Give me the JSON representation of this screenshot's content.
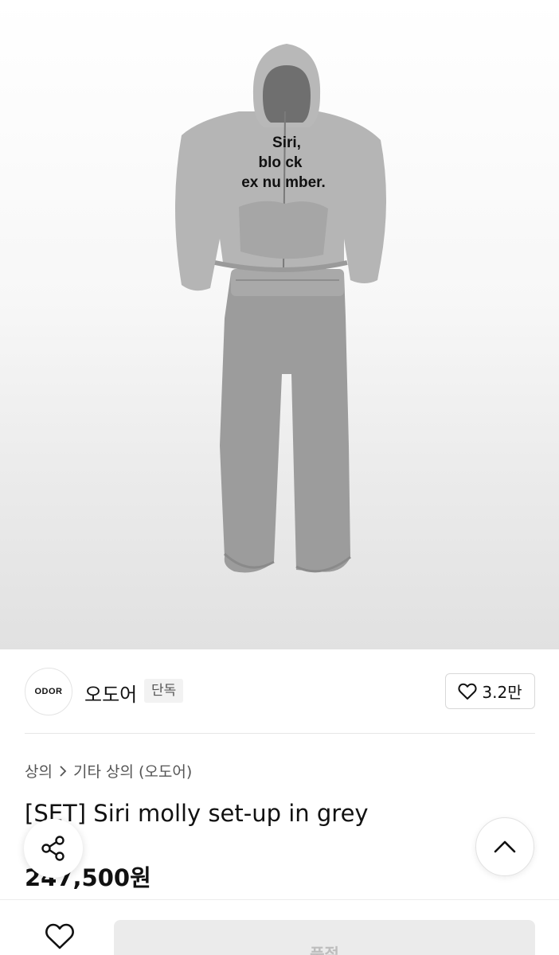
{
  "product_image": {
    "alt_icon": "product-photo",
    "print_text": [
      "Siri,",
      "blo ck",
      "ex nu mber."
    ]
  },
  "brand": {
    "logo_text": "ODOR",
    "name": "오도어",
    "badge": "단독",
    "like_count": "3.2만"
  },
  "breadcrumb": {
    "items": [
      "상의",
      "기타 상의 (오도어)"
    ]
  },
  "product": {
    "title": "[SET] Siri molly set-up in grey",
    "price": "247,500원"
  },
  "bottom_bar": {
    "status_label": "품절"
  },
  "colors": {
    "background": "#ffffff",
    "text": "#111111",
    "muted": "#555555",
    "disabled_bg": "#ebebeb",
    "disabled_text": "#bdbdbd"
  }
}
